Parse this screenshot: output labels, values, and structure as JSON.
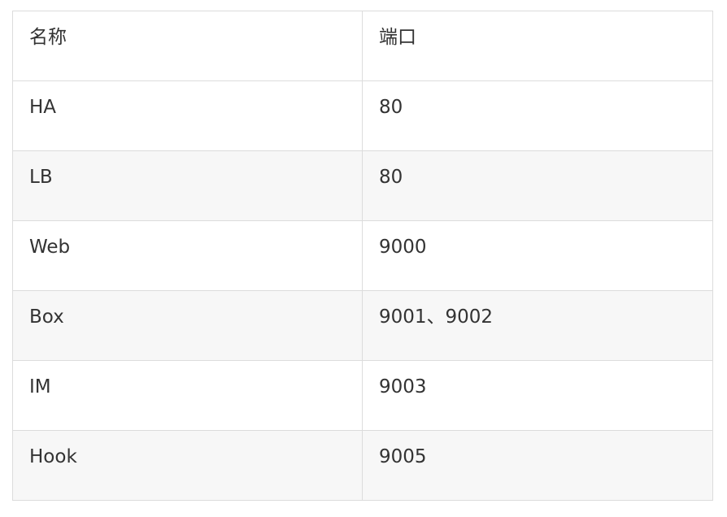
{
  "table": {
    "headers": [
      "名称",
      "端口"
    ],
    "rows": [
      [
        "HA",
        "80"
      ],
      [
        "LB",
        "80"
      ],
      [
        "Web",
        "9000"
      ],
      [
        "Box",
        "9001、9002"
      ],
      [
        "IM",
        "9003"
      ],
      [
        "Hook",
        "9005"
      ]
    ]
  },
  "colors": {
    "border": "#dcdcdc",
    "alt_row_background": "#f7f7f7",
    "text": "#333333"
  }
}
